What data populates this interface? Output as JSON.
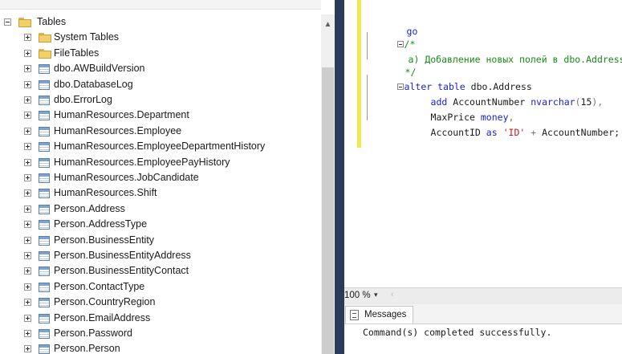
{
  "explorer": {
    "root_label": "Tables",
    "items": [
      {
        "label": "System Tables",
        "kind": "folder"
      },
      {
        "label": "FileTables",
        "kind": "folder"
      },
      {
        "label": "dbo.AWBuildVersion",
        "kind": "table"
      },
      {
        "label": "dbo.DatabaseLog",
        "kind": "table"
      },
      {
        "label": "dbo.ErrorLog",
        "kind": "table"
      },
      {
        "label": "HumanResources.Department",
        "kind": "table"
      },
      {
        "label": "HumanResources.Employee",
        "kind": "table"
      },
      {
        "label": "HumanResources.EmployeeDepartmentHistory",
        "kind": "table"
      },
      {
        "label": "HumanResources.EmployeePayHistory",
        "kind": "table"
      },
      {
        "label": "HumanResources.JobCandidate",
        "kind": "table"
      },
      {
        "label": "HumanResources.Shift",
        "kind": "table"
      },
      {
        "label": "Person.Address",
        "kind": "table"
      },
      {
        "label": "Person.AddressType",
        "kind": "table"
      },
      {
        "label": "Person.BusinessEntity",
        "kind": "table"
      },
      {
        "label": "Person.BusinessEntityAddress",
        "kind": "table"
      },
      {
        "label": "Person.BusinessEntityContact",
        "kind": "table"
      },
      {
        "label": "Person.ContactType",
        "kind": "table"
      },
      {
        "label": "Person.CountryRegion",
        "kind": "table"
      },
      {
        "label": "Person.EmailAddress",
        "kind": "table"
      },
      {
        "label": "Person.Password",
        "kind": "table"
      },
      {
        "label": "Person.Person",
        "kind": "table"
      }
    ]
  },
  "editor": {
    "line1": "go",
    "line2": "/*",
    "line3": "a) Добавление новых полей в dbo.Address",
    "line4": "*/",
    "l5_kw1": "alter",
    "l5_kw2": "table",
    "l5_obj": "dbo.Address",
    "l6_kw": "add",
    "l6_col": "AccountNumber",
    "l6_type": "nvarchar",
    "l6_open": "(",
    "l6_num": "15",
    "l6_close": "),",
    "l7_col": "MaxPrice",
    "l7_type": "money",
    "l7_comma": ",",
    "l8_col": "AccountID",
    "l8_kw": "as",
    "l8_str": "'ID'",
    "l8_op": "+",
    "l8_rest": "AccountNumber;"
  },
  "zoom": {
    "value": "100 %",
    "dropdown_glyph": "▾",
    "left_glyph": "‹"
  },
  "results": {
    "tab_label": "Messages",
    "message": "Command(s) completed successfully."
  },
  "colors": {
    "keyword": "#1a22d6",
    "comment": "#178a17",
    "string": "#c81a1a",
    "splitter": "#2c3b5b",
    "changed_margin": "#f3e84d"
  }
}
